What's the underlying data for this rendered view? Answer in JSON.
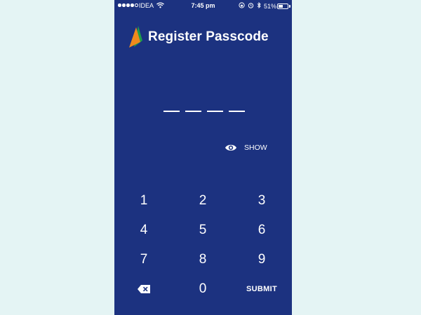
{
  "status_bar": {
    "carrier": "IDEA",
    "time": "7:45 pm",
    "battery_percent": "51%",
    "signal_bars": 4,
    "signal_total": 5,
    "battery_level": 0.51
  },
  "header": {
    "title": "Register Passcode",
    "logo": "flag-logo-icon"
  },
  "passcode": {
    "length": 4
  },
  "show_toggle": {
    "label": "SHOW",
    "icon": "eye-icon"
  },
  "keypad": {
    "keys": [
      "1",
      "2",
      "3",
      "4",
      "5",
      "6",
      "7",
      "8",
      "9"
    ],
    "zero": "0",
    "submit_label": "SUBMIT",
    "backspace_icon": "backspace-icon"
  },
  "colors": {
    "page_background": "#e4f4f4",
    "app_background": "#1c3280",
    "logo_orange": "#f08a1c",
    "logo_green": "#1e9e4a"
  }
}
